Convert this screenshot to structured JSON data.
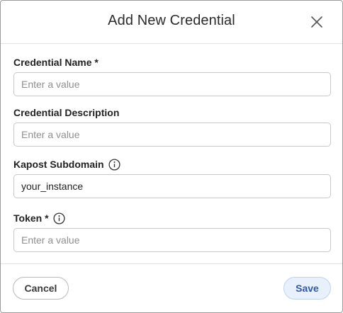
{
  "dialog": {
    "title": "Add New Credential",
    "close_icon": "close-icon"
  },
  "fields": {
    "credential_name": {
      "label": "Credential Name *",
      "placeholder": "Enter a value",
      "value": ""
    },
    "credential_description": {
      "label": "Credential Description",
      "placeholder": "Enter a value",
      "value": ""
    },
    "kapost_subdomain": {
      "label": "Kapost Subdomain",
      "info_icon": "info-icon",
      "placeholder": "",
      "value": "your_instance"
    },
    "token": {
      "label": "Token *",
      "info_icon": "info-icon",
      "placeholder": "Enter a value",
      "value": ""
    }
  },
  "footer": {
    "cancel_label": "Cancel",
    "save_label": "Save"
  },
  "colors": {
    "save_bg": "#e8f1fb",
    "save_text": "#2e5aa8",
    "border": "#c8c8c8"
  }
}
